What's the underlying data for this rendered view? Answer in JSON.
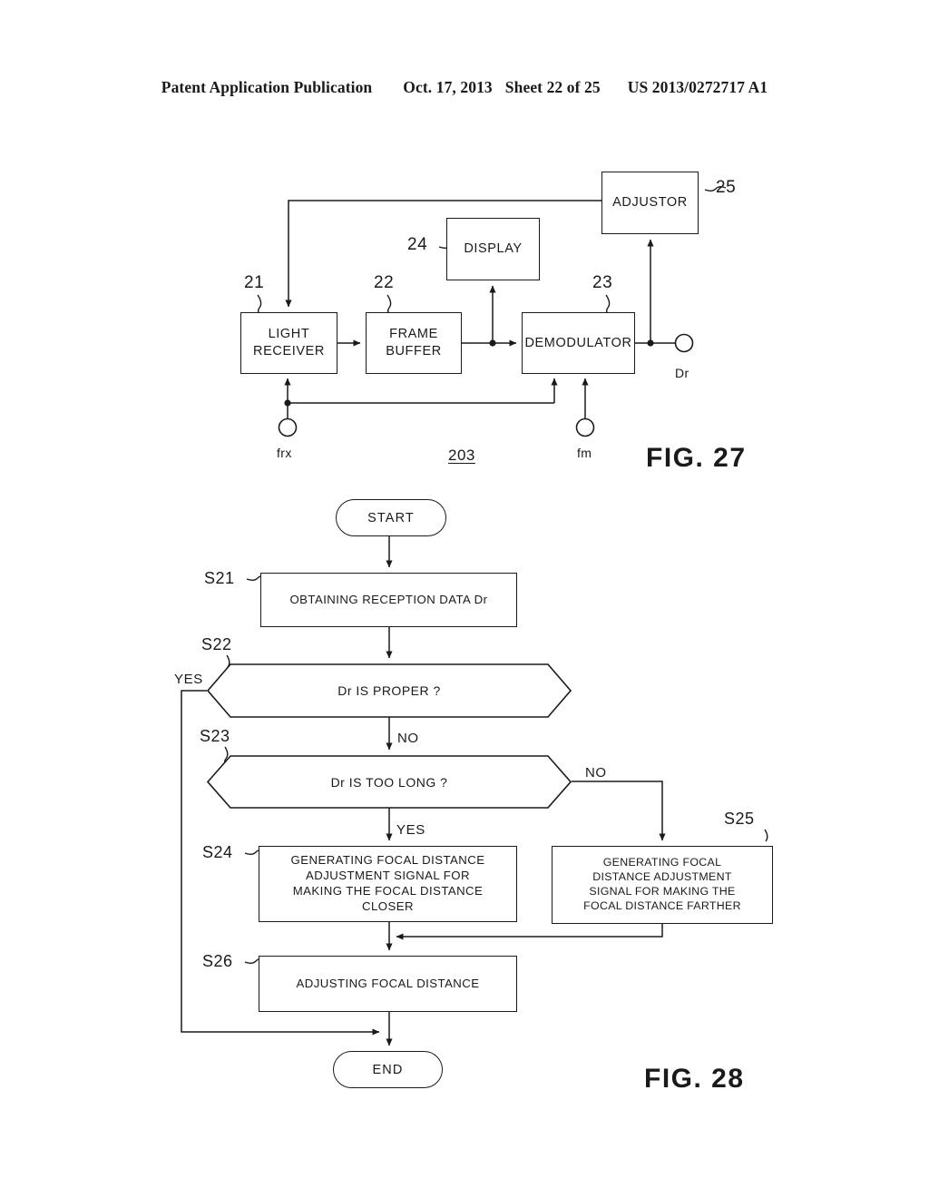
{
  "header": {
    "publication": "Patent Application Publication",
    "date": "Oct. 17, 2013",
    "sheet": "Sheet 22 of 25",
    "docnum": "US 2013/0272717 A1"
  },
  "figure27": {
    "caption": "FIG. 27",
    "system_number": "203",
    "blocks": [
      {
        "id": "light-receiver",
        "ref": "21",
        "line1": "LIGHT",
        "line2": "RECEIVER"
      },
      {
        "id": "frame-buffer",
        "ref": "22",
        "line1": "FRAME",
        "line2": "BUFFER"
      },
      {
        "id": "demodulator",
        "ref": "23",
        "line1": "DEMODULATOR",
        "line2": ""
      },
      {
        "id": "display",
        "ref": "24",
        "line1": "DISPLAY",
        "line2": ""
      },
      {
        "id": "adjustor",
        "ref": "25",
        "line1": "ADJUSTOR",
        "line2": ""
      }
    ],
    "terminals": [
      {
        "id": "frx",
        "label": "frx"
      },
      {
        "id": "fm",
        "label": "fm"
      },
      {
        "id": "dr",
        "label": "Dr"
      }
    ]
  },
  "figure28": {
    "caption": "FIG. 28",
    "start_label": "START",
    "end_label": "END",
    "steps": [
      {
        "id": "S21",
        "tag": "S21",
        "text": "OBTAINING RECEPTION DATA Dr"
      },
      {
        "id": "S22",
        "tag": "S22",
        "text": "Dr IS PROPER ?"
      },
      {
        "id": "S23",
        "tag": "S23",
        "text": "Dr IS TOO LONG ?"
      },
      {
        "id": "S24",
        "tag": "S24",
        "lines": [
          "GENERATING FOCAL DISTANCE",
          "ADJUSTMENT SIGNAL FOR",
          "MAKING THE FOCAL DISTANCE",
          "CLOSER"
        ]
      },
      {
        "id": "S25",
        "tag": "S25",
        "lines": [
          "GENERATING FOCAL",
          "DISTANCE ADJUSTMENT",
          "SIGNAL FOR MAKING THE",
          "FOCAL DISTANCE FARTHER"
        ]
      },
      {
        "id": "S26",
        "tag": "S26",
        "text": "ADJUSTING FOCAL DISTANCE"
      }
    ],
    "branch_labels": {
      "s22_yes": "YES",
      "s22_no": "NO",
      "s23_yes": "YES",
      "s23_no": "NO"
    }
  }
}
